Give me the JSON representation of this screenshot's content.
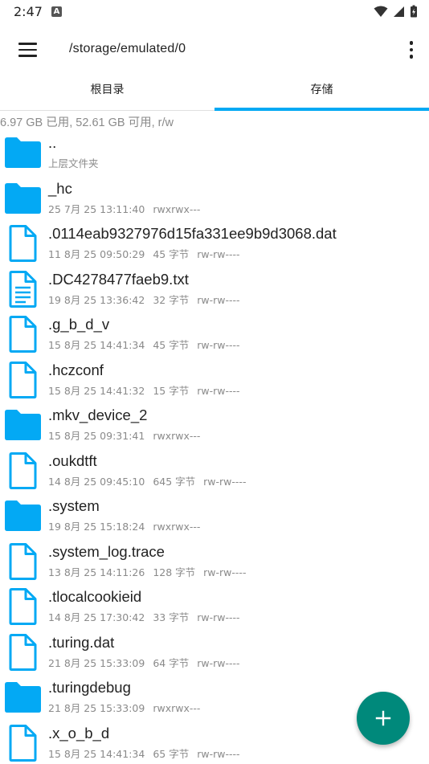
{
  "status_bar": {
    "time": "2:47",
    "notification_icon": "A"
  },
  "appbar": {
    "path": "/storage/emulated/0"
  },
  "tabs": [
    {
      "label": "根目录"
    },
    {
      "label": "存储"
    }
  ],
  "storage_info": "6.97 GB 已用, 52.61 GB 可用, r/w",
  "files": [
    {
      "type": "folder",
      "name": "..",
      "date": "上层文件夹",
      "size": "",
      "perm": ""
    },
    {
      "type": "folder",
      "name": "_hc",
      "date": "25 7月 25 13:11:40",
      "size": "",
      "perm": "rwxrwx---"
    },
    {
      "type": "file",
      "name": ".0114eab9327976d15fa331ee9b9d3068.dat",
      "date": "11 8月 25 09:50:29",
      "size": "45 字节",
      "perm": "rw-rw----"
    },
    {
      "type": "text",
      "name": ".DC4278477faeb9.txt",
      "date": "19 8月 25 13:36:42",
      "size": "32 字节",
      "perm": "rw-rw----"
    },
    {
      "type": "file",
      "name": ".g_b_d_v",
      "date": "15 8月 25 14:41:34",
      "size": "45 字节",
      "perm": "rw-rw----"
    },
    {
      "type": "file",
      "name": ".hczconf",
      "date": "15 8月 25 14:41:32",
      "size": "15 字节",
      "perm": "rw-rw----"
    },
    {
      "type": "folder",
      "name": ".mkv_device_2",
      "date": "15 8月 25 09:31:41",
      "size": "",
      "perm": "rwxrwx---"
    },
    {
      "type": "file",
      "name": ".oukdtft",
      "date": "14 8月 25 09:45:10",
      "size": "645 字节",
      "perm": "rw-rw----"
    },
    {
      "type": "folder",
      "name": ".system",
      "date": "19 8月 25 15:18:24",
      "size": "",
      "perm": "rwxrwx---"
    },
    {
      "type": "file",
      "name": ".system_log.trace",
      "date": "13 8月 25 14:11:26",
      "size": "128 字节",
      "perm": "rw-rw----"
    },
    {
      "type": "file",
      "name": ".tlocalcookieid",
      "date": "14 8月 25 17:30:42",
      "size": "33 字节",
      "perm": "rw-rw----"
    },
    {
      "type": "file",
      "name": ".turing.dat",
      "date": "21 8月 25 15:33:09",
      "size": "64 字节",
      "perm": "rw-rw----"
    },
    {
      "type": "folder",
      "name": ".turingdebug",
      "date": "21 8月 25 15:33:09",
      "size": "",
      "perm": "rwxrwx---"
    },
    {
      "type": "file",
      "name": ".x_o_b_d",
      "date": "15 8月 25 14:41:34",
      "size": "65 字节",
      "perm": "rw-rw----"
    }
  ],
  "icons": {
    "folder": "folder-icon",
    "file": "file-icon",
    "text": "text-file-icon",
    "fab": "add-icon"
  },
  "colors": {
    "accent": "#03a9f4",
    "folder": "#03a9f4",
    "fab": "#00897b"
  }
}
